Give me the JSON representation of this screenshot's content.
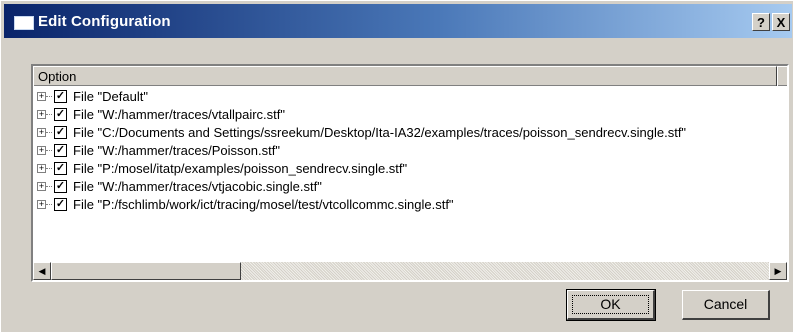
{
  "window": {
    "title": "Edit Configuration"
  },
  "titlebar_buttons": {
    "help": "?",
    "close": "X"
  },
  "table": {
    "column_header": "Option",
    "rows": [
      {
        "checked": true,
        "label": "File \"Default\""
      },
      {
        "checked": true,
        "label": "File \"W:/hammer/traces/vtallpairc.stf\""
      },
      {
        "checked": true,
        "label": "File \"C:/Documents and Settings/ssreekum/Desktop/Ita-IA32/examples/traces/poisson_sendrecv.single.stf\""
      },
      {
        "checked": true,
        "label": "File \"W:/hammer/traces/Poisson.stf\""
      },
      {
        "checked": true,
        "label": "File \"P:/mosel/itatp/examples/poisson_sendrecv.single.stf\""
      },
      {
        "checked": true,
        "label": "File \"W:/hammer/traces/vtjacobic.single.stf\""
      },
      {
        "checked": true,
        "label": "File \"P:/fschlimb/work/ict/tracing/mosel/test/vtcollcommc.single.stf\""
      }
    ]
  },
  "buttons": {
    "ok": "OK",
    "cancel": "Cancel"
  },
  "colors": {
    "title_start": "#0a246a",
    "title_end": "#a6caf0",
    "face": "#d4d0c8"
  }
}
